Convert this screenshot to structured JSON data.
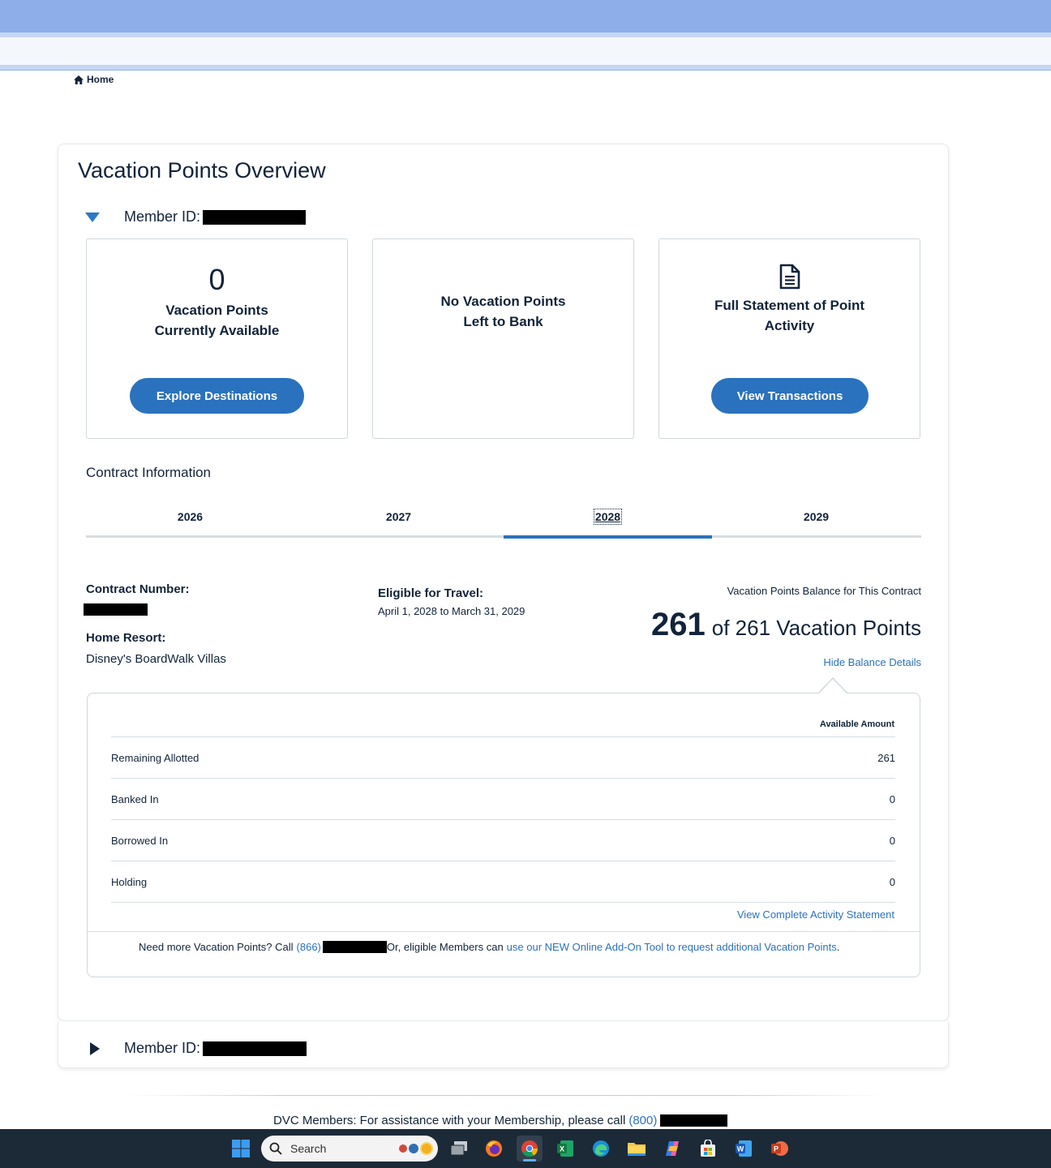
{
  "breadcrumb": {
    "home_label": "Home"
  },
  "page_title": "Vacation Points Overview",
  "member": {
    "label": "Member ID:",
    "second_label": "Member ID:"
  },
  "tiles": {
    "available_count": "0",
    "available_line1": "Vacation Points",
    "available_line2": "Currently Available",
    "explore_button": "Explore Destinations",
    "bank_line1": "No Vacation Points",
    "bank_line2": "Left to Bank",
    "statement_line1": "Full Statement of Point",
    "statement_line2": "Activity",
    "transactions_button": "View Transactions",
    "statement_icon": "document-icon"
  },
  "contract": {
    "section_title": "Contract Information",
    "tabs": [
      "2026",
      "2027",
      "2028",
      "2029"
    ],
    "active_tab": "2028",
    "number_label": "Contract Number:",
    "home_resort_label": "Home Resort:",
    "home_resort_value": "Disney's BoardWalk Villas",
    "eligible_label": "Eligible for Travel:",
    "eligible_value": "April 1, 2028 to March 31, 2029",
    "balance_title": "Vacation Points Balance for This Contract",
    "balance_value": "261",
    "balance_rest": "of 261 Vacation Points",
    "hide_details_link": "Hide Balance Details"
  },
  "details": {
    "column_header": "Available Amount",
    "rows": [
      {
        "label": "Remaining Allotted",
        "value": "261"
      },
      {
        "label": "Banked In",
        "value": "0"
      },
      {
        "label": "Borrowed In",
        "value": "0"
      },
      {
        "label": "Holding",
        "value": "0"
      }
    ],
    "complete_statement_link": "View Complete Activity Statement",
    "need_more_prefix": "Need more Vacation Points? Call",
    "need_more_area": "(866)",
    "need_more_middle": "Or, eligible Members can",
    "need_more_link": "use our NEW Online Add-On Tool to request additional Vacation Points",
    "need_more_suffix": "."
  },
  "footer": {
    "text": "DVC Members: For assistance with your Membership, please call",
    "area": "(800)"
  },
  "taskbar": {
    "search_placeholder": "Search",
    "icons": [
      "windows-start-icon",
      "task-view-icon",
      "firefox-icon",
      "chrome-icon",
      "excel-icon",
      "edge-icon",
      "file-explorer-icon",
      "copilot-icon",
      "store-icon",
      "word-icon",
      "powerpoint-icon"
    ]
  },
  "colors": {
    "accent": "#2a72bd",
    "text": "#12233a",
    "browser_bar": "#8eaeea",
    "taskbar": "#1c2a38"
  }
}
